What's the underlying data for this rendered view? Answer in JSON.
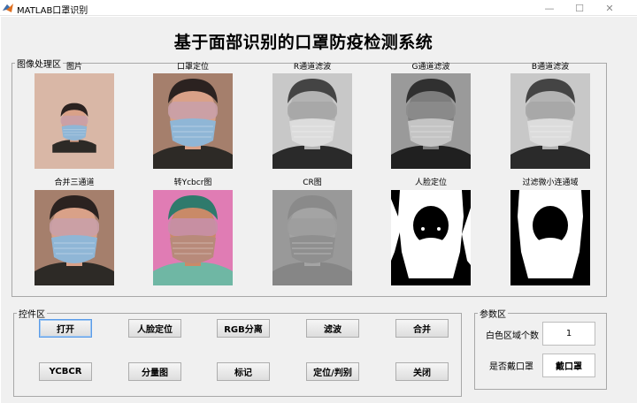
{
  "window": {
    "title": "MATLAB口罩识别"
  },
  "main_title": "基于面部识别的口罩防疫检测系统",
  "image_panel": {
    "legend": "图像处理区",
    "images": [
      {
        "label": "图片",
        "kind": "photo"
      },
      {
        "label": "口罩定位",
        "kind": "photo-closeup"
      },
      {
        "label": "R通道滤波",
        "kind": "gray"
      },
      {
        "label": "G通道滤波",
        "kind": "gray-dark"
      },
      {
        "label": "B通道滤波",
        "kind": "gray"
      },
      {
        "label": "合并三通道",
        "kind": "photo-closeup"
      },
      {
        "label": "转Ycbcr图",
        "kind": "ycbcr"
      },
      {
        "label": "CR图",
        "kind": "cr"
      },
      {
        "label": "人脸定位",
        "kind": "binary-face"
      },
      {
        "label": "过滤微小连通域",
        "kind": "binary-filtered"
      }
    ]
  },
  "control_panel": {
    "legend": "控件区",
    "buttons_row1": [
      "打开",
      "人脸定位",
      "RGB分离",
      "滤波",
      "合并"
    ],
    "buttons_row2": [
      "YCBCR",
      "分量图",
      "标记",
      "定位/判别",
      "关闭"
    ]
  },
  "param_panel": {
    "legend": "参数区",
    "white_region_count_label": "白色区域个数",
    "white_region_count_value": "1",
    "mask_status_label": "是否戴口罩",
    "mask_status_value": "戴口罩"
  },
  "colors": {
    "window_bg": "#f0f0f0",
    "button_focus_border": "#5a9be8",
    "skin": "#d9a188",
    "mask_blue": "#8fb6d6",
    "ycbcr_pink": "#e07cb4",
    "ycbcr_teal": "#6fb7a4"
  },
  "icons": {
    "app": "matlab-logo-icon",
    "minimize": "minimize-icon",
    "maximize": "maximize-icon",
    "close": "close-icon"
  }
}
